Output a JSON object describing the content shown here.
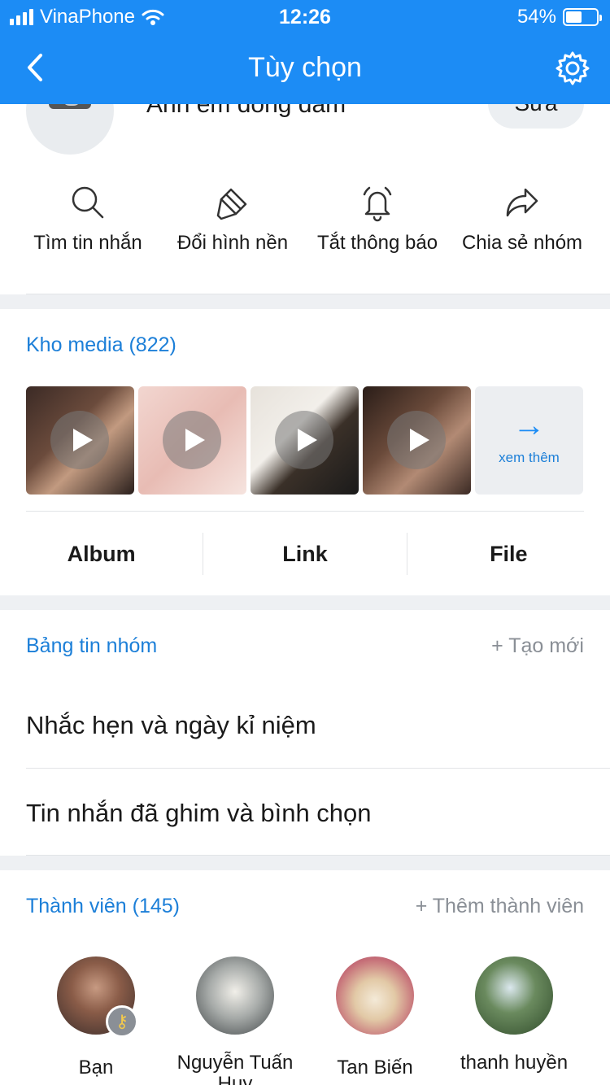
{
  "status_bar": {
    "carrier": "VinaPhone",
    "time": "12:26",
    "battery": "54%",
    "battery_level": 0.54
  },
  "nav": {
    "title": "Tùy chọn",
    "back_icon": "chevron-left-icon",
    "settings_icon": "gear-icon"
  },
  "group": {
    "name": "Anh em dong dam",
    "edit_label": "Sửa"
  },
  "actions": [
    {
      "label": "Tìm tin nhắn",
      "icon": "search-icon"
    },
    {
      "label": "Đổi hình nền",
      "icon": "paint-brush-icon"
    },
    {
      "label": "Tắt thông báo",
      "icon": "bell-icon"
    },
    {
      "label": "Chia sẻ nhóm",
      "icon": "share-icon"
    }
  ],
  "media": {
    "title": "Kho media (822)",
    "more_label": "xem thêm",
    "tabs": [
      "Album",
      "Link",
      "File"
    ]
  },
  "board": {
    "title": "Bảng tin nhóm",
    "create_label": "+ Tạo mới",
    "items": [
      "Nhắc hẹn và ngày kỉ niệm",
      "Tin nhắn đã ghim và bình chọn"
    ]
  },
  "members": {
    "title": "Thành viên (145)",
    "add_label": "+ Thêm thành viên",
    "list": [
      {
        "name": "Bạn"
      },
      {
        "name": "Nguyễn Tuấn Huy"
      },
      {
        "name": "Tan Biến"
      },
      {
        "name": "thanh huyền"
      }
    ]
  },
  "colors": {
    "primary": "#1c8cf5",
    "link": "#1c7fd8",
    "muted": "#8a8f96"
  }
}
